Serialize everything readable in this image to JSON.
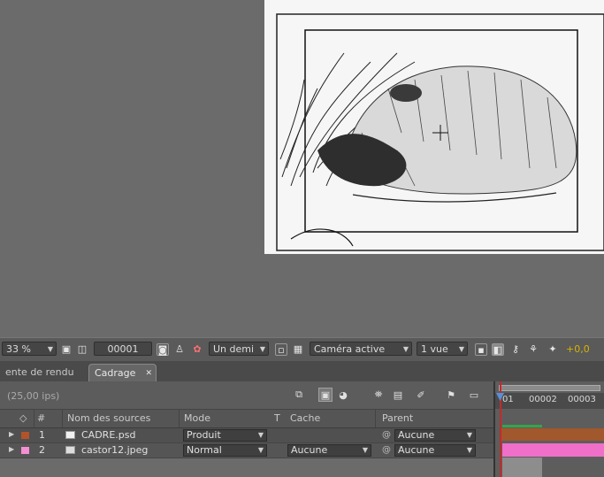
{
  "viewer_toolbar": {
    "magnification": "33 %",
    "timecode": "00001",
    "resolution": "Un demi",
    "camera": "Caméra active",
    "views": "1 vue",
    "exposure": "+0,0"
  },
  "tabs": {
    "render_queue": "ente de rendu",
    "active": "Cadrage"
  },
  "timeline": {
    "fps": "(25,00 ips)",
    "columns": {
      "hash": "#",
      "source_name": "Nom des sources",
      "mode": "Mode",
      "t": "T",
      "cache": "Cache",
      "parent": "Parent"
    },
    "layers": [
      {
        "number": "1",
        "name": "CADRE.psd",
        "mode": "Produit",
        "cache": "",
        "parent": "Aucune",
        "color": "#b2532a"
      },
      {
        "number": "2",
        "name": "castor12.jpeg",
        "mode": "Normal",
        "cache": "Aucune",
        "parent": "Aucune",
        "color": "#f48fd3"
      }
    ],
    "ruler": [
      "01",
      "00002",
      "00003"
    ]
  },
  "colors": {
    "layer1_bar": "#a0582c",
    "layer2_bar": "#f06fc9",
    "playhead": "#c42a2a",
    "exposure": "#d8b200"
  },
  "icons": {
    "canvas_crosshair": "crosshair-icon",
    "snapshot": "camera-icon",
    "channels": "rgb-channels-icon",
    "grid": "grid-icon",
    "transparency": "checkerboard-icon",
    "fast_preview": "lightning-icon",
    "flowchart": "flowchart-icon"
  }
}
